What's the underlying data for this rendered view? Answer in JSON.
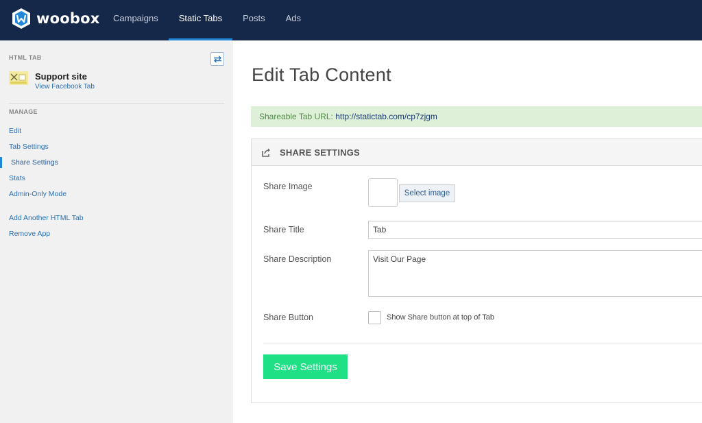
{
  "brand": {
    "name": "woobox"
  },
  "nav": {
    "items": [
      {
        "label": "Campaigns"
      },
      {
        "label": "Static Tabs"
      },
      {
        "label": "Posts"
      },
      {
        "label": "Ads"
      }
    ],
    "active": "Static Tabs"
  },
  "sidebar": {
    "section_label": "HTML TAB",
    "page": {
      "name": "Support site",
      "link": "View Facebook Tab"
    },
    "manage_label": "MANAGE",
    "items": [
      {
        "label": "Edit"
      },
      {
        "label": "Tab Settings"
      },
      {
        "label": "Share Settings"
      },
      {
        "label": "Stats"
      },
      {
        "label": "Admin-Only Mode"
      }
    ],
    "active": "Share Settings",
    "extra": [
      {
        "label": "Add Another HTML Tab"
      },
      {
        "label": "Remove App"
      }
    ]
  },
  "main": {
    "title": "Edit Tab Content",
    "url_label": "Shareable Tab URL:",
    "url_value": "http://statictab.com/cp7zjgm",
    "panel": {
      "title": "SHARE SETTINGS",
      "share_image_label": "Share Image",
      "select_image_label": "Select image",
      "share_title_label": "Share Title",
      "share_title_value": "Tab",
      "share_description_label": "Share Description",
      "share_description_value": "Visit Our Page",
      "share_button_label": "Share Button",
      "share_button_checkbox_label": "Show Share button at top of Tab",
      "share_button_checked": false,
      "save_label": "Save Settings"
    }
  },
  "colors": {
    "topbar": "#16284a",
    "accent": "#1f86d8",
    "save_button": "#1fe085",
    "url_bar": "#dff0d8"
  }
}
